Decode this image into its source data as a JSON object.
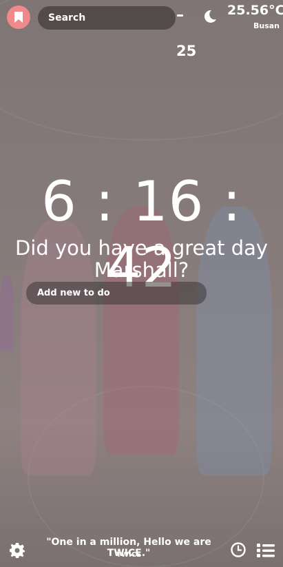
{
  "header": {
    "search_placeholder": "Search",
    "weather": {
      "temperature": "25.56°C",
      "city": "Busan",
      "icon": "moon-icon"
    },
    "day_number": "25"
  },
  "main": {
    "time": "6 : 16 : 42",
    "greeting": "Did you have a great day Marshall?",
    "todo_placeholder": "Add new to do"
  },
  "footer": {
    "quote": "\"One in a million, Hello we are TWICE.\"",
    "author": "TWICE",
    "icons": [
      "gear-icon",
      "clock-icon",
      "list-icon"
    ]
  },
  "colors": {
    "accent": "#f08a8a",
    "background": "#857a79",
    "text": "#ffffff"
  }
}
